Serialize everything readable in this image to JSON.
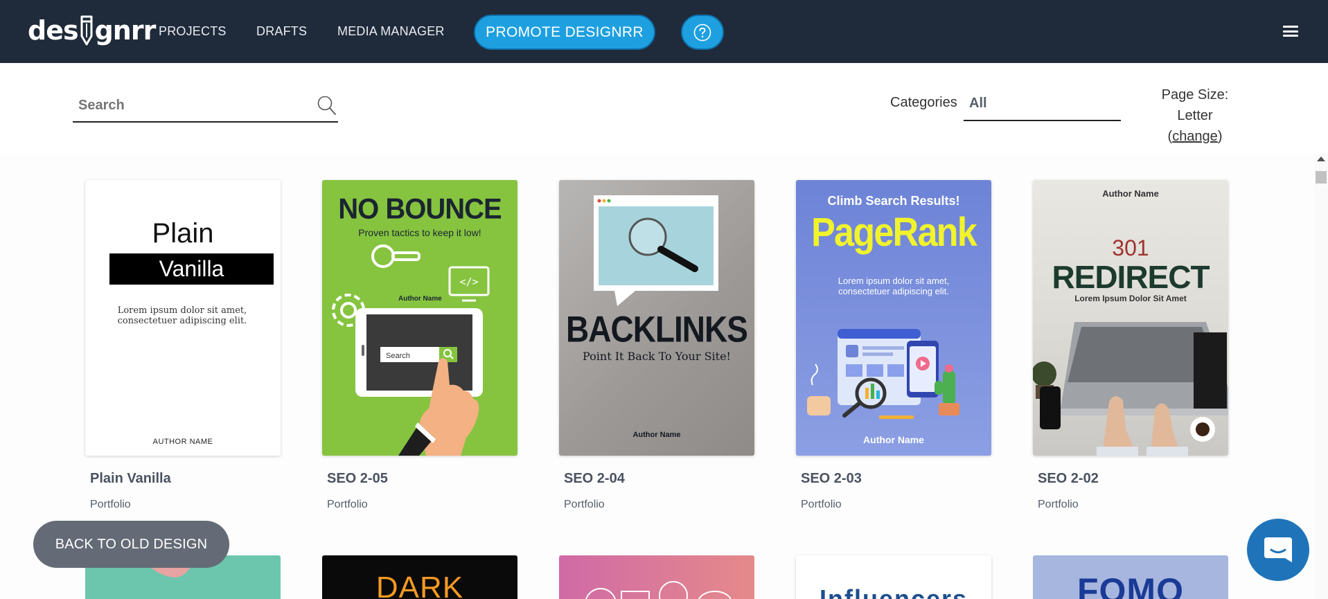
{
  "app": {
    "logo_text_left": "des",
    "logo_text_right": "gnrr"
  },
  "nav": {
    "links": [
      {
        "label": "PROJECTS"
      },
      {
        "label": "DRAFTS"
      },
      {
        "label": "MEDIA MANAGER"
      }
    ],
    "promote_label": "PROMOTE DESIGNRR",
    "help_icon": "question-circle-icon",
    "menu_icon": "hamburger-menu-icon",
    "colors": {
      "bar": "#1f2a3a",
      "accent": "#1ea0e0"
    }
  },
  "filters": {
    "search": {
      "placeholder": "Search",
      "value": ""
    },
    "categories_label": "Categories",
    "categories_value": "All",
    "page_size_label": "Page Size:",
    "page_size_value": "Letter",
    "page_size_change": "change"
  },
  "templates": [
    {
      "title": "Plain Vanilla",
      "category": "Portfolio",
      "cover": {
        "line1": "Plain",
        "line2": "Vanilla",
        "lorem": "Lorem ipsum dolor sit amet, consectetuer adipiscing elit.",
        "author": "AUTHOR NAME"
      }
    },
    {
      "title": "SEO 2-05",
      "category": "Portfolio",
      "cover": {
        "headline": "NO BOUNCE",
        "subtitle": "Proven tactics to keep it low!",
        "author": "Author Name",
        "search_text": "Search"
      }
    },
    {
      "title": "SEO 2-04",
      "category": "Portfolio",
      "cover": {
        "headline": "BACKLINKS",
        "subtitle": "Point It Back To Your Site!",
        "author": "Author Name"
      }
    },
    {
      "title": "SEO 2-03",
      "category": "Portfolio",
      "cover": {
        "top": "Climb Search Results!",
        "headline": "PageRank",
        "lorem": "Lorem ipsum dolor sit amet, consectetuer adipiscing elit.",
        "author": "Author Name"
      }
    },
    {
      "title": "SEO 2-02",
      "category": "Portfolio",
      "cover": {
        "author": "Author Name",
        "number": "301",
        "headline": "REDIRECT",
        "subtitle": "Lorem Ipsum Dolor Sit Amet"
      }
    }
  ],
  "row2": [
    {
      "cover_text": ""
    },
    {
      "cover_text": "DARK"
    },
    {
      "cover_text": ""
    },
    {
      "cover_text": "Influencers"
    },
    {
      "cover_text": "FOMO"
    }
  ],
  "floating": {
    "old_design_label": "BACK TO OLD DESIGN",
    "chat_icon": "chat-bubble-icon"
  }
}
